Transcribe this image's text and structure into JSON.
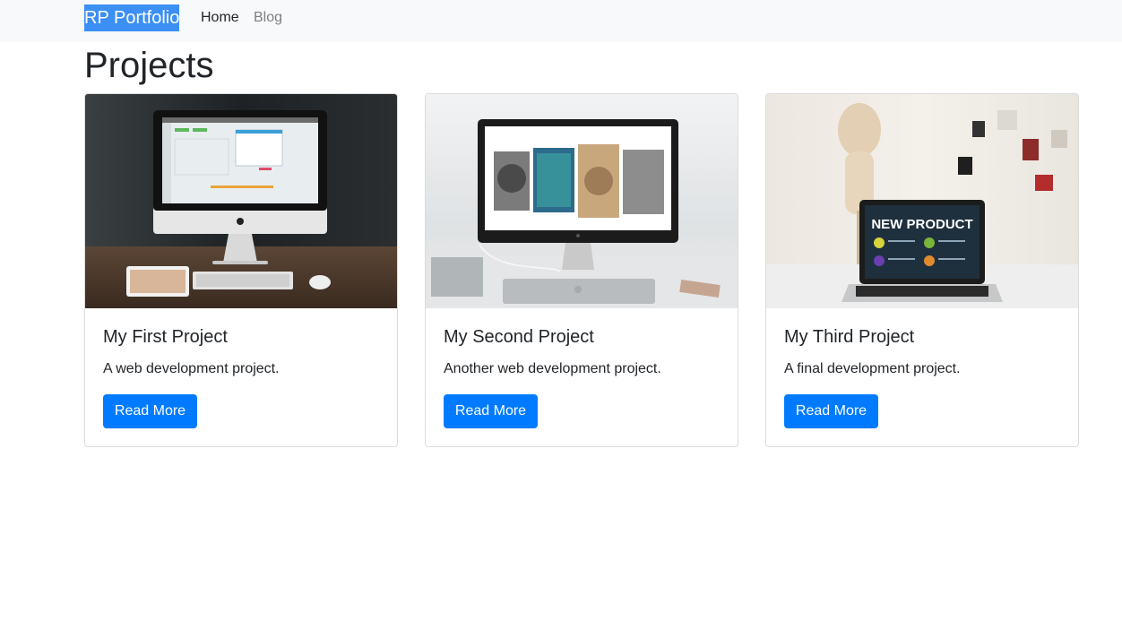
{
  "navbar": {
    "brand": "RP Portfolio",
    "links": [
      {
        "label": "Home"
      },
      {
        "label": "Blog"
      }
    ]
  },
  "page": {
    "title": "Projects"
  },
  "cards": [
    {
      "title": "My First Project",
      "text": "A web development project.",
      "button": "Read More"
    },
    {
      "title": "My Second Project",
      "text": "Another web development project.",
      "button": "Read More"
    },
    {
      "title": "My Third Project",
      "text": "A final development project.",
      "button": "Read More",
      "image_text": "NEW PRODUCT"
    }
  ],
  "colors": {
    "brand_bg": "#3b8ff5",
    "primary_button": "#007bff",
    "navbar_bg": "#f8f9fa"
  }
}
